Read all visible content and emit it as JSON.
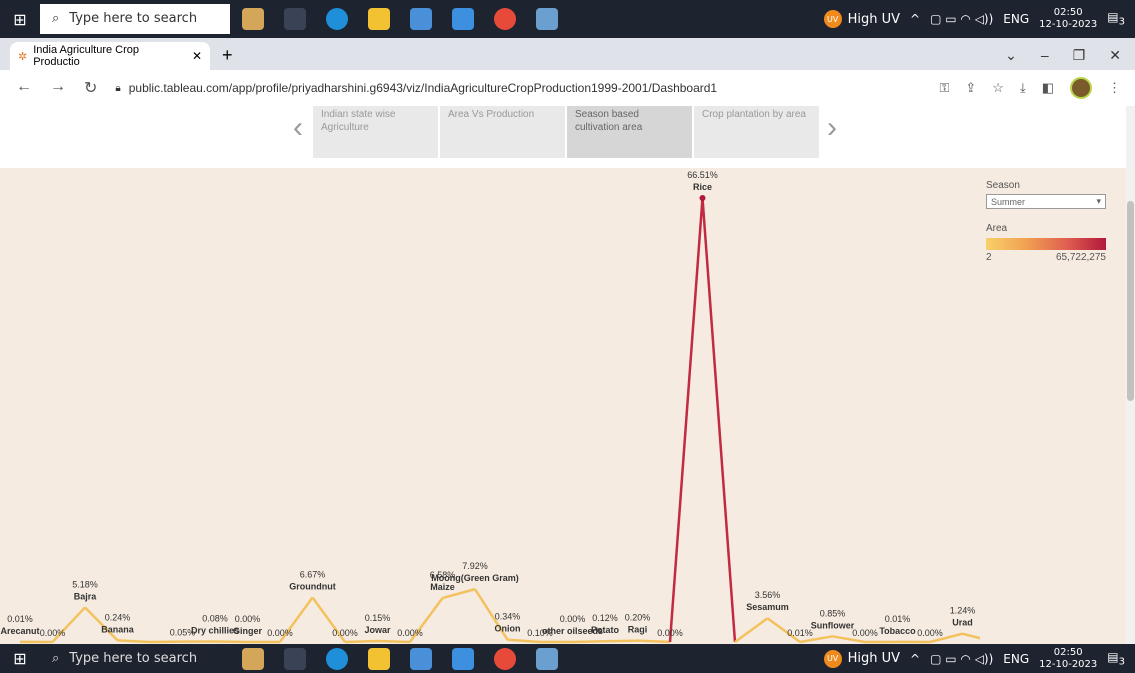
{
  "taskbar": {
    "search_placeholder": "Type here to search",
    "weather": "High UV",
    "weather_badge": "UV",
    "lang": "ENG",
    "time": "02:50",
    "date": "12-10-2023",
    "notif_count": "3"
  },
  "browser": {
    "tab_title": "India Agriculture Crop Productio",
    "url": "public.tableau.com/app/profile/priyadharshini.g6943/viz/IndiaAgricultureCropProduction1999-2001/Dashboard1"
  },
  "story": {
    "items": [
      {
        "label": "Indian state wise Agriculture"
      },
      {
        "label": "Area Vs Production"
      },
      {
        "label": "Season based cultivation area"
      },
      {
        "label": "Crop plantation by area"
      }
    ]
  },
  "legend": {
    "filter_title": "Season",
    "filter_value": "Summer",
    "color_title": "Area",
    "color_min": "2",
    "color_max": "65,722,275"
  },
  "chart_data": {
    "type": "line",
    "series": [
      {
        "name": "Area",
        "points": [
          {
            "crop": "Arecanut",
            "pct": 0.01,
            "label": "0.01%"
          },
          {
            "crop": "",
            "pct": 0.0,
            "label": "0.00%"
          },
          {
            "crop": "Bajra",
            "pct": 5.18,
            "label": "5.18%"
          },
          {
            "crop": "Banana",
            "pct": 0.24,
            "label": "0.24%"
          },
          {
            "crop": "",
            "pct": 0.0,
            "label": ""
          },
          {
            "crop": "",
            "pct": 0.05,
            "label": "0.05%"
          },
          {
            "crop": "Dry chillies",
            "pct": 0.08,
            "label": "0.08%"
          },
          {
            "crop": "Ginger",
            "pct": 0.0,
            "label": "0.00%"
          },
          {
            "crop": "",
            "pct": 0.0,
            "label": "0.00%"
          },
          {
            "crop": "Groundnut",
            "pct": 6.67,
            "label": "6.67%"
          },
          {
            "crop": "",
            "pct": 0.0,
            "label": "0.00%"
          },
          {
            "crop": "Jowar",
            "pct": 0.15,
            "label": "0.15%"
          },
          {
            "crop": "",
            "pct": 0.0,
            "label": "0.00%"
          },
          {
            "crop": "Maize",
            "pct": 6.58,
            "label": "6.58%"
          },
          {
            "crop": "Moong(Green Gram)",
            "pct": 7.92,
            "label": "7.92%"
          },
          {
            "crop": "Onion",
            "pct": 0.34,
            "label": "0.34%"
          },
          {
            "crop": "",
            "pct": 0.0,
            "label": "0.10%"
          },
          {
            "crop": "other oilseeds",
            "pct": 0.0,
            "label": "0.00%"
          },
          {
            "crop": "Potato",
            "pct": 0.12,
            "label": "0.12%"
          },
          {
            "crop": "Ragi",
            "pct": 0.2,
            "label": "0.20%"
          },
          {
            "crop": "",
            "pct": 0.0,
            "label": "0.00%"
          },
          {
            "crop": "Rice",
            "pct": 66.51,
            "label": "66.51%"
          },
          {
            "crop": "",
            "pct": 0.0,
            "label": ""
          },
          {
            "crop": "Sesamum",
            "pct": 3.56,
            "label": "3.56%"
          },
          {
            "crop": "",
            "pct": 0.0,
            "label": "0.01%"
          },
          {
            "crop": "Sunflower",
            "pct": 0.85,
            "label": "0.85%"
          },
          {
            "crop": "",
            "pct": 0.0,
            "label": "0.00%"
          },
          {
            "crop": "Tobacco",
            "pct": 0.01,
            "label": "0.01%"
          },
          {
            "crop": "",
            "pct": 0.0,
            "label": "0.00%"
          },
          {
            "crop": "Urad",
            "pct": 1.24,
            "label": "1.24%"
          },
          {
            "crop": "",
            "pct": 0.0,
            "label": "0.0%"
          }
        ]
      }
    ],
    "ylim": [
      0,
      66.51
    ]
  }
}
